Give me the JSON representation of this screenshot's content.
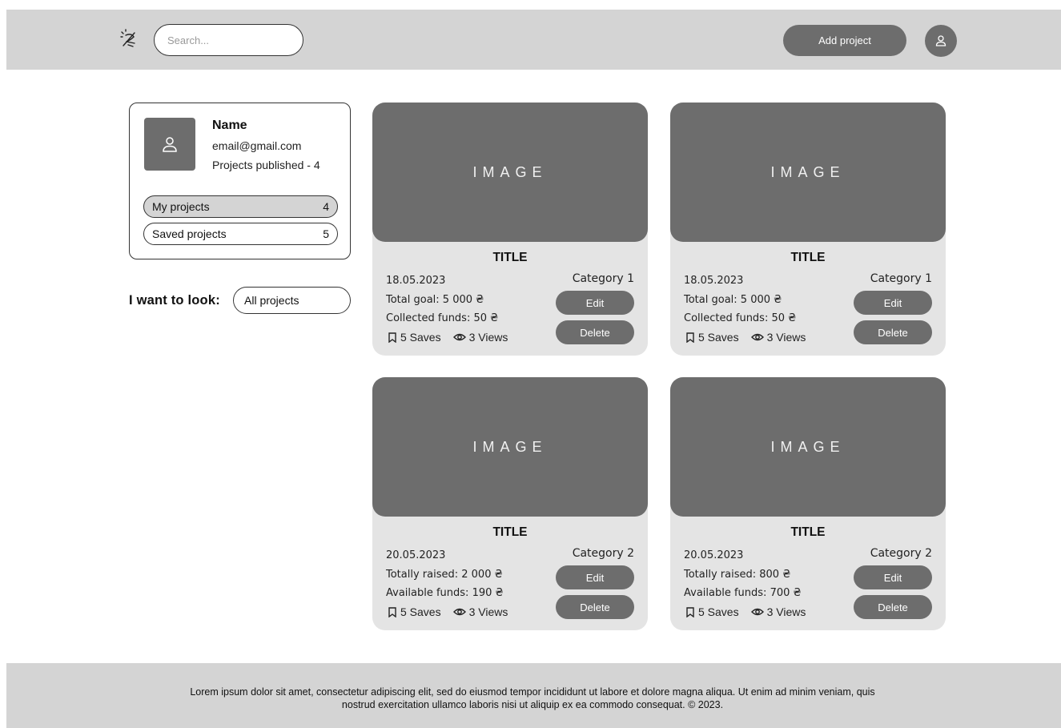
{
  "header": {
    "search_placeholder": "Search...",
    "add_project_label": "Add project"
  },
  "profile": {
    "name": "Name",
    "email": "email@gmail.com",
    "published": "Projects published - 4",
    "menu": [
      {
        "label": "My projects",
        "count": "4",
        "active": true
      },
      {
        "label": "Saved projects",
        "count": "5",
        "active": false
      }
    ]
  },
  "filter": {
    "label": "I want to look:",
    "selected": "All projects"
  },
  "projects": [
    {
      "image_label": "IMAGE",
      "title": "TITLE",
      "date": "18.05.2023",
      "category": "Category 1",
      "line1": "Total goal: 5 000 ₴",
      "line2": "Collected funds: 50 ₴",
      "saves": "5 Saves",
      "views": "3 Views",
      "edit_label": "Edit",
      "delete_label": "Delete"
    },
    {
      "image_label": "IMAGE",
      "title": "TITLE",
      "date": "18.05.2023",
      "category": "Category 1",
      "line1": "Total goal: 5 000 ₴",
      "line2": "Collected funds: 50 ₴",
      "saves": "5 Saves",
      "views": "3 Views",
      "edit_label": "Edit",
      "delete_label": "Delete"
    },
    {
      "image_label": "IMAGE",
      "title": "TITLE",
      "date": "20.05.2023",
      "category": "Category 2",
      "line1": "Totally raised: 2 000 ₴",
      "line2": "Available funds: 190 ₴",
      "saves": "5 Saves",
      "views": "3 Views",
      "edit_label": "Edit",
      "delete_label": "Delete"
    },
    {
      "image_label": "IMAGE",
      "title": "TITLE",
      "date": "20.05.2023",
      "category": "Category 2",
      "line1": "Totally raised: 800 ₴",
      "line2": "Available funds: 700 ₴",
      "saves": "5 Saves",
      "views": "3 Views",
      "edit_label": "Edit",
      "delete_label": "Delete"
    }
  ],
  "footer": {
    "text": "Lorem ipsum dolor sit amet, consectetur adipiscing elit, sed do eiusmod tempor incididunt ut labore et dolore magna aliqua. Ut enim ad minim veniam, quis nostrud exercitation ullamco laboris nisi ut aliquip ex ea commodo consequat. © 2023."
  },
  "icons": {
    "logo": "broken-lightbulb-logo-icon",
    "avatar": "user-icon",
    "saves": "bookmark-icon",
    "views": "eye-icon"
  },
  "colors": {
    "header_bg": "#d4d4d4",
    "button_bg": "#6d6d6d",
    "card_bg": "#e4e4e4"
  }
}
